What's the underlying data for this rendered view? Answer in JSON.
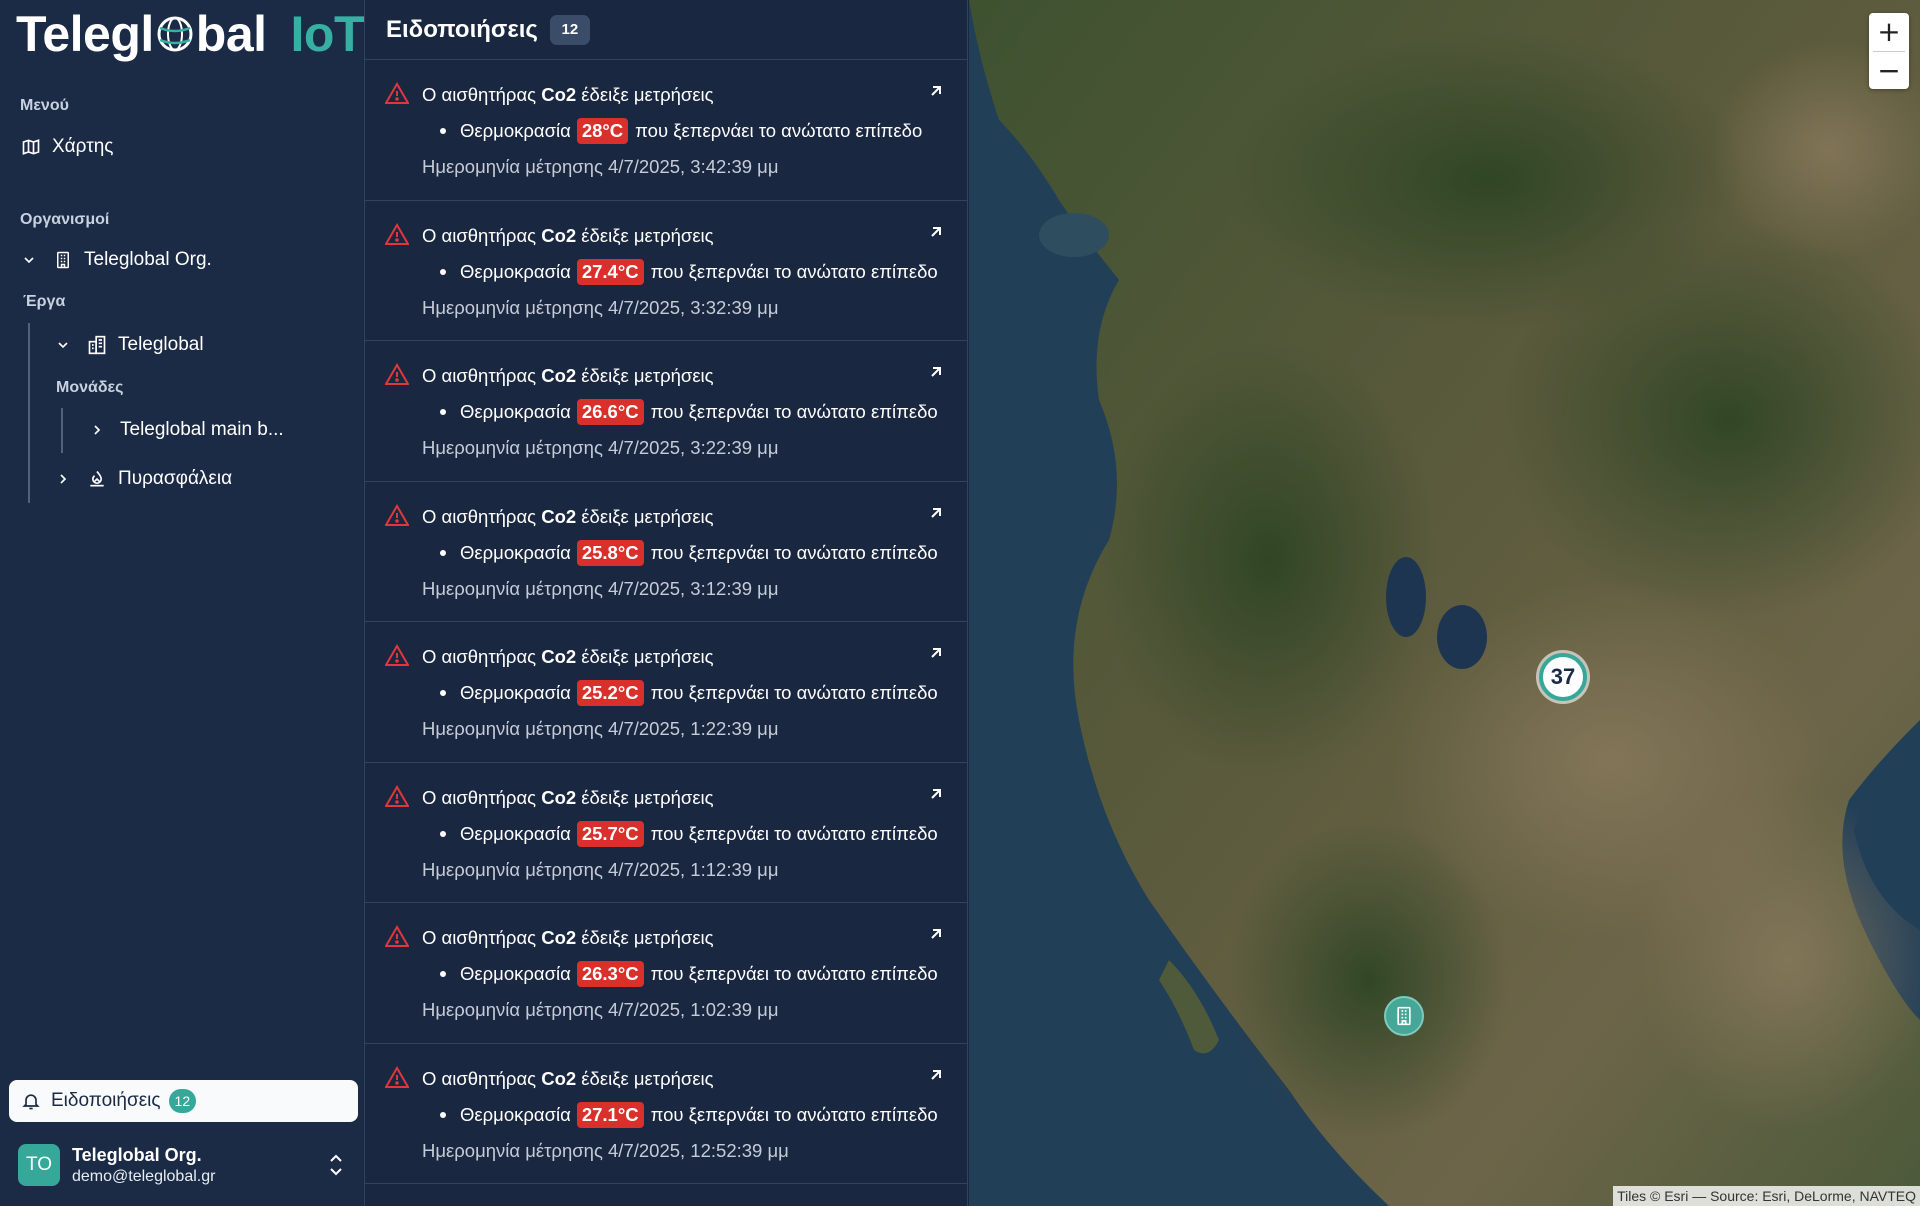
{
  "logo": {
    "brand_left": "Telegl",
    "brand_right": "bal",
    "suffix": "IoT",
    "accent_color": "#36b0a2"
  },
  "sidebar": {
    "menu_label": "Μενού",
    "menu_items": [
      {
        "label": "Χάρτης",
        "icon": "map-icon"
      }
    ],
    "orgs_label": "Οργανισμοί",
    "org": {
      "label": "Teleglobal Org.",
      "icon": "building-icon",
      "expanded": true
    },
    "projects_label": "Έργα",
    "project": {
      "label": "Teleglobal",
      "icon": "office-building-icon",
      "expanded": true
    },
    "units_label": "Μονάδες",
    "unit": {
      "label": "Teleglobal main b...",
      "expanded": false
    },
    "project2": {
      "label": "Πυρασφάλεια",
      "icon": "fire-safety-icon",
      "expanded": false
    },
    "notifications_button": {
      "label": "Ειδοποιήσεις",
      "count": "12"
    },
    "user": {
      "initials": "TO",
      "name": "Teleglobal Org.",
      "email": "demo@teleglobal.gr"
    }
  },
  "panel": {
    "title": "Ειδοποιήσεις",
    "count": "12",
    "sensor_prefix": "Ο αισθητήρας",
    "sensor_suffix": "έδειξε μετρήσεις",
    "metric_label": "Θερμοκρασία",
    "exceed_text": "που ξεπερνάει το ανώτατο επίπεδο",
    "date_prefix": "Ημερομηνία μέτρησης",
    "items": [
      {
        "sensor": "Co2",
        "value": "28°C",
        "date": "4/7/2025, 3:42:39 μμ"
      },
      {
        "sensor": "Co2",
        "value": "27.4°C",
        "date": "4/7/2025, 3:32:39 μμ"
      },
      {
        "sensor": "Co2",
        "value": "26.6°C",
        "date": "4/7/2025, 3:22:39 μμ"
      },
      {
        "sensor": "Co2",
        "value": "25.8°C",
        "date": "4/7/2025, 3:12:39 μμ"
      },
      {
        "sensor": "Co2",
        "value": "25.2°C",
        "date": "4/7/2025, 1:22:39 μμ"
      },
      {
        "sensor": "Co2",
        "value": "25.7°C",
        "date": "4/7/2025, 1:12:39 μμ"
      },
      {
        "sensor": "Co2",
        "value": "26.3°C",
        "date": "4/7/2025, 1:02:39 μμ"
      },
      {
        "sensor": "Co2",
        "value": "27.1°C",
        "date": "4/7/2025, 12:52:39 μμ"
      }
    ]
  },
  "map": {
    "zoom_in": "+",
    "zoom_out": "−",
    "cluster_count": "37",
    "attribution": "Tiles © Esri — Source: Esri, DeLorme, NAVTEQ"
  }
}
